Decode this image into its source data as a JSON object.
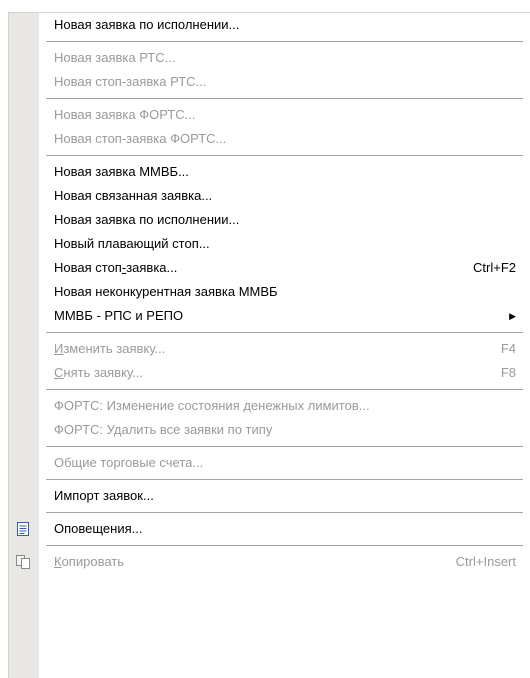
{
  "menu": {
    "items": [
      {
        "label": "Новая заявка по исполнении...",
        "shortcut": "",
        "disabled": false
      },
      {
        "sep": true
      },
      {
        "label": "Новая заявка РТС...",
        "shortcut": "",
        "disabled": true
      },
      {
        "label": "Новая стоп-заявка РТС...",
        "shortcut": "",
        "disabled": true
      },
      {
        "sep": true
      },
      {
        "label": "Новая заявка ФОРТС...",
        "shortcut": "",
        "disabled": true
      },
      {
        "label": "Новая стоп-заявка ФОРТС...",
        "shortcut": "",
        "disabled": true
      },
      {
        "sep": true
      },
      {
        "label": "Новая заявка ММВБ...",
        "shortcut": "",
        "disabled": false
      },
      {
        "label": "Новая связанная заявка...",
        "shortcut": "",
        "disabled": false
      },
      {
        "label": "Новая заявка по исполнении...",
        "shortcut": "",
        "disabled": false
      },
      {
        "label": "Новый плавающий стоп...",
        "shortcut": "",
        "disabled": false
      },
      {
        "label": "Новая стоп-заявка...",
        "shortcut": "Ctrl+F2",
        "disabled": false
      },
      {
        "label": "Новая неконкурентная заявка ММВБ",
        "shortcut": "",
        "disabled": false
      },
      {
        "label": "ММВБ - РПС и РЕПО",
        "shortcut": "",
        "disabled": false,
        "submenu": true
      },
      {
        "sep": true
      },
      {
        "label": "Изменить заявку...",
        "shortcut": "F4",
        "disabled": true
      },
      {
        "label": "Снять заявку...",
        "shortcut": "F8",
        "disabled": true
      },
      {
        "sep": true
      },
      {
        "label": "ФОРТС: Изменение состояния денежных лимитов...",
        "shortcut": "",
        "disabled": true
      },
      {
        "label": "ФОРТС: Удалить все заявки по типу",
        "shortcut": "",
        "disabled": true
      },
      {
        "sep": true
      },
      {
        "label": "Общие торговые счета...",
        "shortcut": "",
        "disabled": true
      },
      {
        "sep": true
      },
      {
        "label": "Импорт заявок...",
        "shortcut": "",
        "disabled": false
      },
      {
        "sep": true
      },
      {
        "label": "Оповещения...",
        "shortcut": "",
        "disabled": false,
        "icon": "notes-icon"
      },
      {
        "sep": true
      },
      {
        "label": "Копировать",
        "shortcut": "Ctrl+Insert",
        "disabled": true,
        "icon": "copy-icon"
      }
    ]
  },
  "colors": {
    "gutter": "#e9e7e3",
    "disabled_text": "#9a9a9a",
    "icon_blue": "#2f5fb3"
  }
}
